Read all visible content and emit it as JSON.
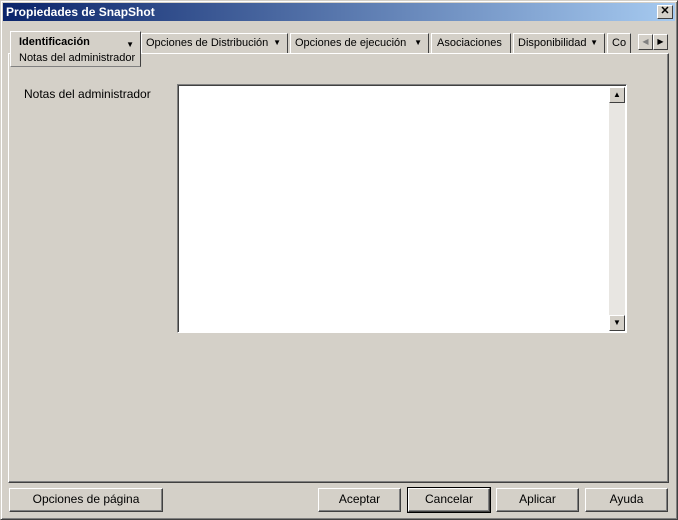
{
  "window": {
    "title": "Propiedades de SnapShot",
    "close_glyph": "✕"
  },
  "tabs": [
    {
      "label": "Identificación",
      "subtab": "Notas del administrador",
      "active": true
    },
    {
      "label": "Opciones de Distribución"
    },
    {
      "label": "Opciones de ejecución"
    },
    {
      "label": "Asociaciones"
    },
    {
      "label": "Disponibilidad"
    },
    {
      "label": "Co"
    }
  ],
  "arrows": {
    "down": "▼",
    "left": "◀",
    "right": "▶",
    "up": "▲"
  },
  "content": {
    "notes_label": "Notas del administrador",
    "notes_value": ""
  },
  "buttons": {
    "page_options": "Opciones de página",
    "accept": "Aceptar",
    "cancel": "Cancelar",
    "apply": "Aplicar",
    "help": "Ayuda"
  }
}
